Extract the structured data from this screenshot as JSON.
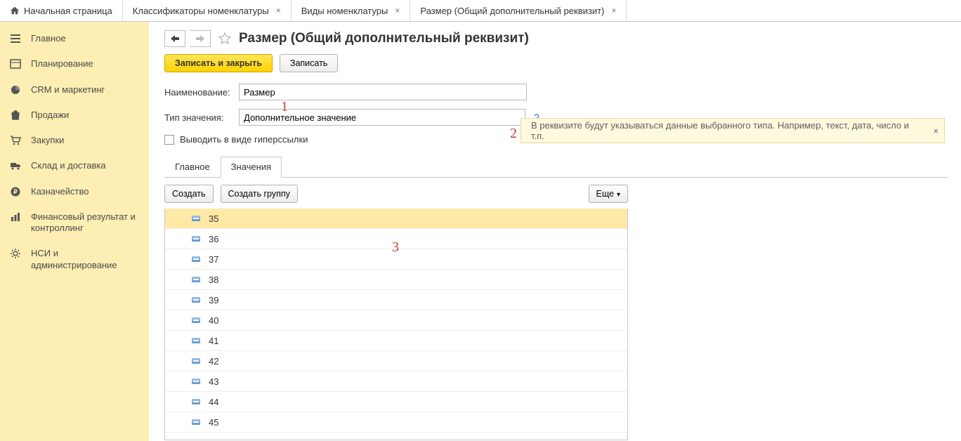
{
  "tabs": {
    "home": "Начальная страница",
    "t1": "Классификаторы номенклатуры",
    "t2": "Виды номенклатуры",
    "t3": "Размер (Общий дополнительный реквизит)"
  },
  "sidebar": {
    "items": [
      {
        "label": "Главное"
      },
      {
        "label": "Планирование"
      },
      {
        "label": "CRM и маркетинг"
      },
      {
        "label": "Продажи"
      },
      {
        "label": "Закупки"
      },
      {
        "label": "Склад и доставка"
      },
      {
        "label": "Казначейство"
      },
      {
        "label": "Финансовый результат и контроллинг"
      },
      {
        "label": "НСИ и администрирование"
      }
    ]
  },
  "page": {
    "title": "Размер (Общий дополнительный реквизит)",
    "save_close": "Записать и закрыть",
    "save": "Записать"
  },
  "fields": {
    "name_label": "Наименование:",
    "name_value": "Размер",
    "type_label": "Тип значения:",
    "type_value": "Дополнительное значение",
    "show_as_link": "Выводить в виде гиперссылки",
    "help": "?"
  },
  "subtabs": {
    "main": "Главное",
    "values": "Значения"
  },
  "grid_toolbar": {
    "create": "Создать",
    "create_group": "Создать группу",
    "more": "Еще"
  },
  "grid_rows": [
    "35",
    "36",
    "37",
    "38",
    "39",
    "40",
    "41",
    "42",
    "43",
    "44",
    "45"
  ],
  "tooltip": {
    "text": "В реквизите будут указываться данные выбранного типа. Например, текст, дата, число и т.п."
  },
  "markers": {
    "m1": "1",
    "m2": "2",
    "m3": "3"
  }
}
